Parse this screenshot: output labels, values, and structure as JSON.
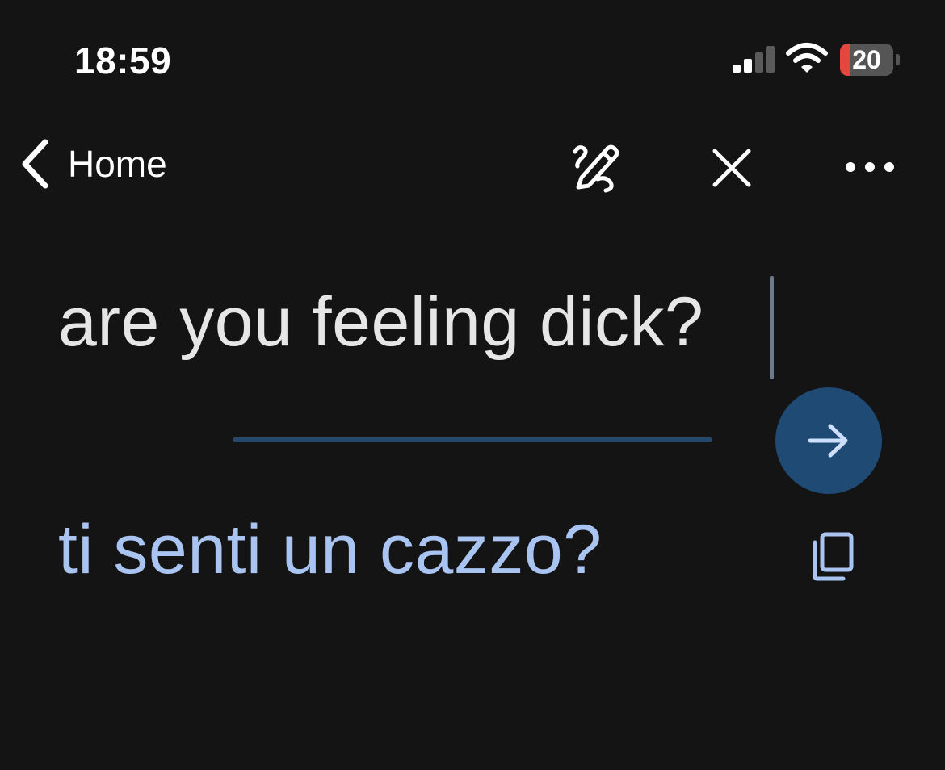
{
  "status_bar": {
    "time": "18:59",
    "battery_level": "20",
    "battery_fraction": 0.2,
    "battery_low_color": "#e5463f",
    "signal_bars_active": 2,
    "signal_bars_total": 4
  },
  "nav": {
    "back_label": "Home",
    "back_icon": "chevron-left-icon",
    "handwriting_icon": "handwriting-pen-icon",
    "close_icon": "close-icon",
    "more_icon": "more-horizontal-icon"
  },
  "input": {
    "source_text": "are you feeling dick?"
  },
  "translate_button": {
    "icon": "arrow-right-icon",
    "color": "#1f4a74"
  },
  "output": {
    "translated_text": "ti senti un cazzo?",
    "text_color": "#aac4f2",
    "copy_icon": "copy-icon"
  }
}
